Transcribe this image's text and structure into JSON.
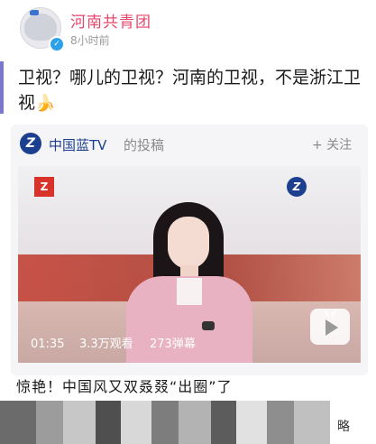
{
  "post": {
    "author": "河南共青团",
    "time": "8小时前",
    "text": "卫视？哪儿的卫视？河南的卫视，不是浙江卫视",
    "emoji": "🍌"
  },
  "shared": {
    "source_name": "中国蓝TV",
    "source_suffix": "的投稿",
    "follow_label": "+ 关注",
    "logo_letter": "Z",
    "video": {
      "duration": "01:35",
      "views": "3.3万观看",
      "danmaku": "273弹幕"
    },
    "title": "惊艳！中国风又双叒叕“出圈”了"
  },
  "footer": {
    "more_label": "略"
  },
  "colors": {
    "author": "#e8466b",
    "source": "#1d3f8f",
    "accent_bar": "#7b77cc"
  }
}
